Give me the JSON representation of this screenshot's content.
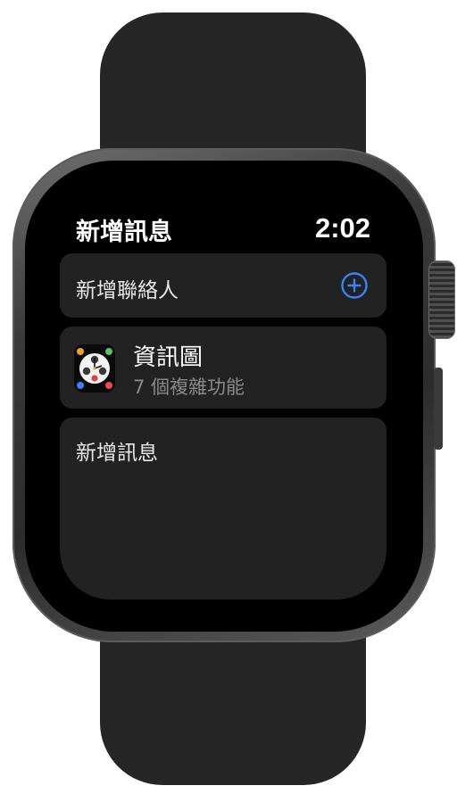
{
  "header": {
    "title": "新增訊息",
    "time": "2:02"
  },
  "add_contact": {
    "label": "新增聯絡人",
    "icon": "plus-circle-icon",
    "accent_color": "#3a82f7"
  },
  "watch_face": {
    "name": "資訊圖",
    "detail": "7 個複雜功能",
    "icon": "infograph-face-icon"
  },
  "message": {
    "placeholder": "新增訊息"
  }
}
